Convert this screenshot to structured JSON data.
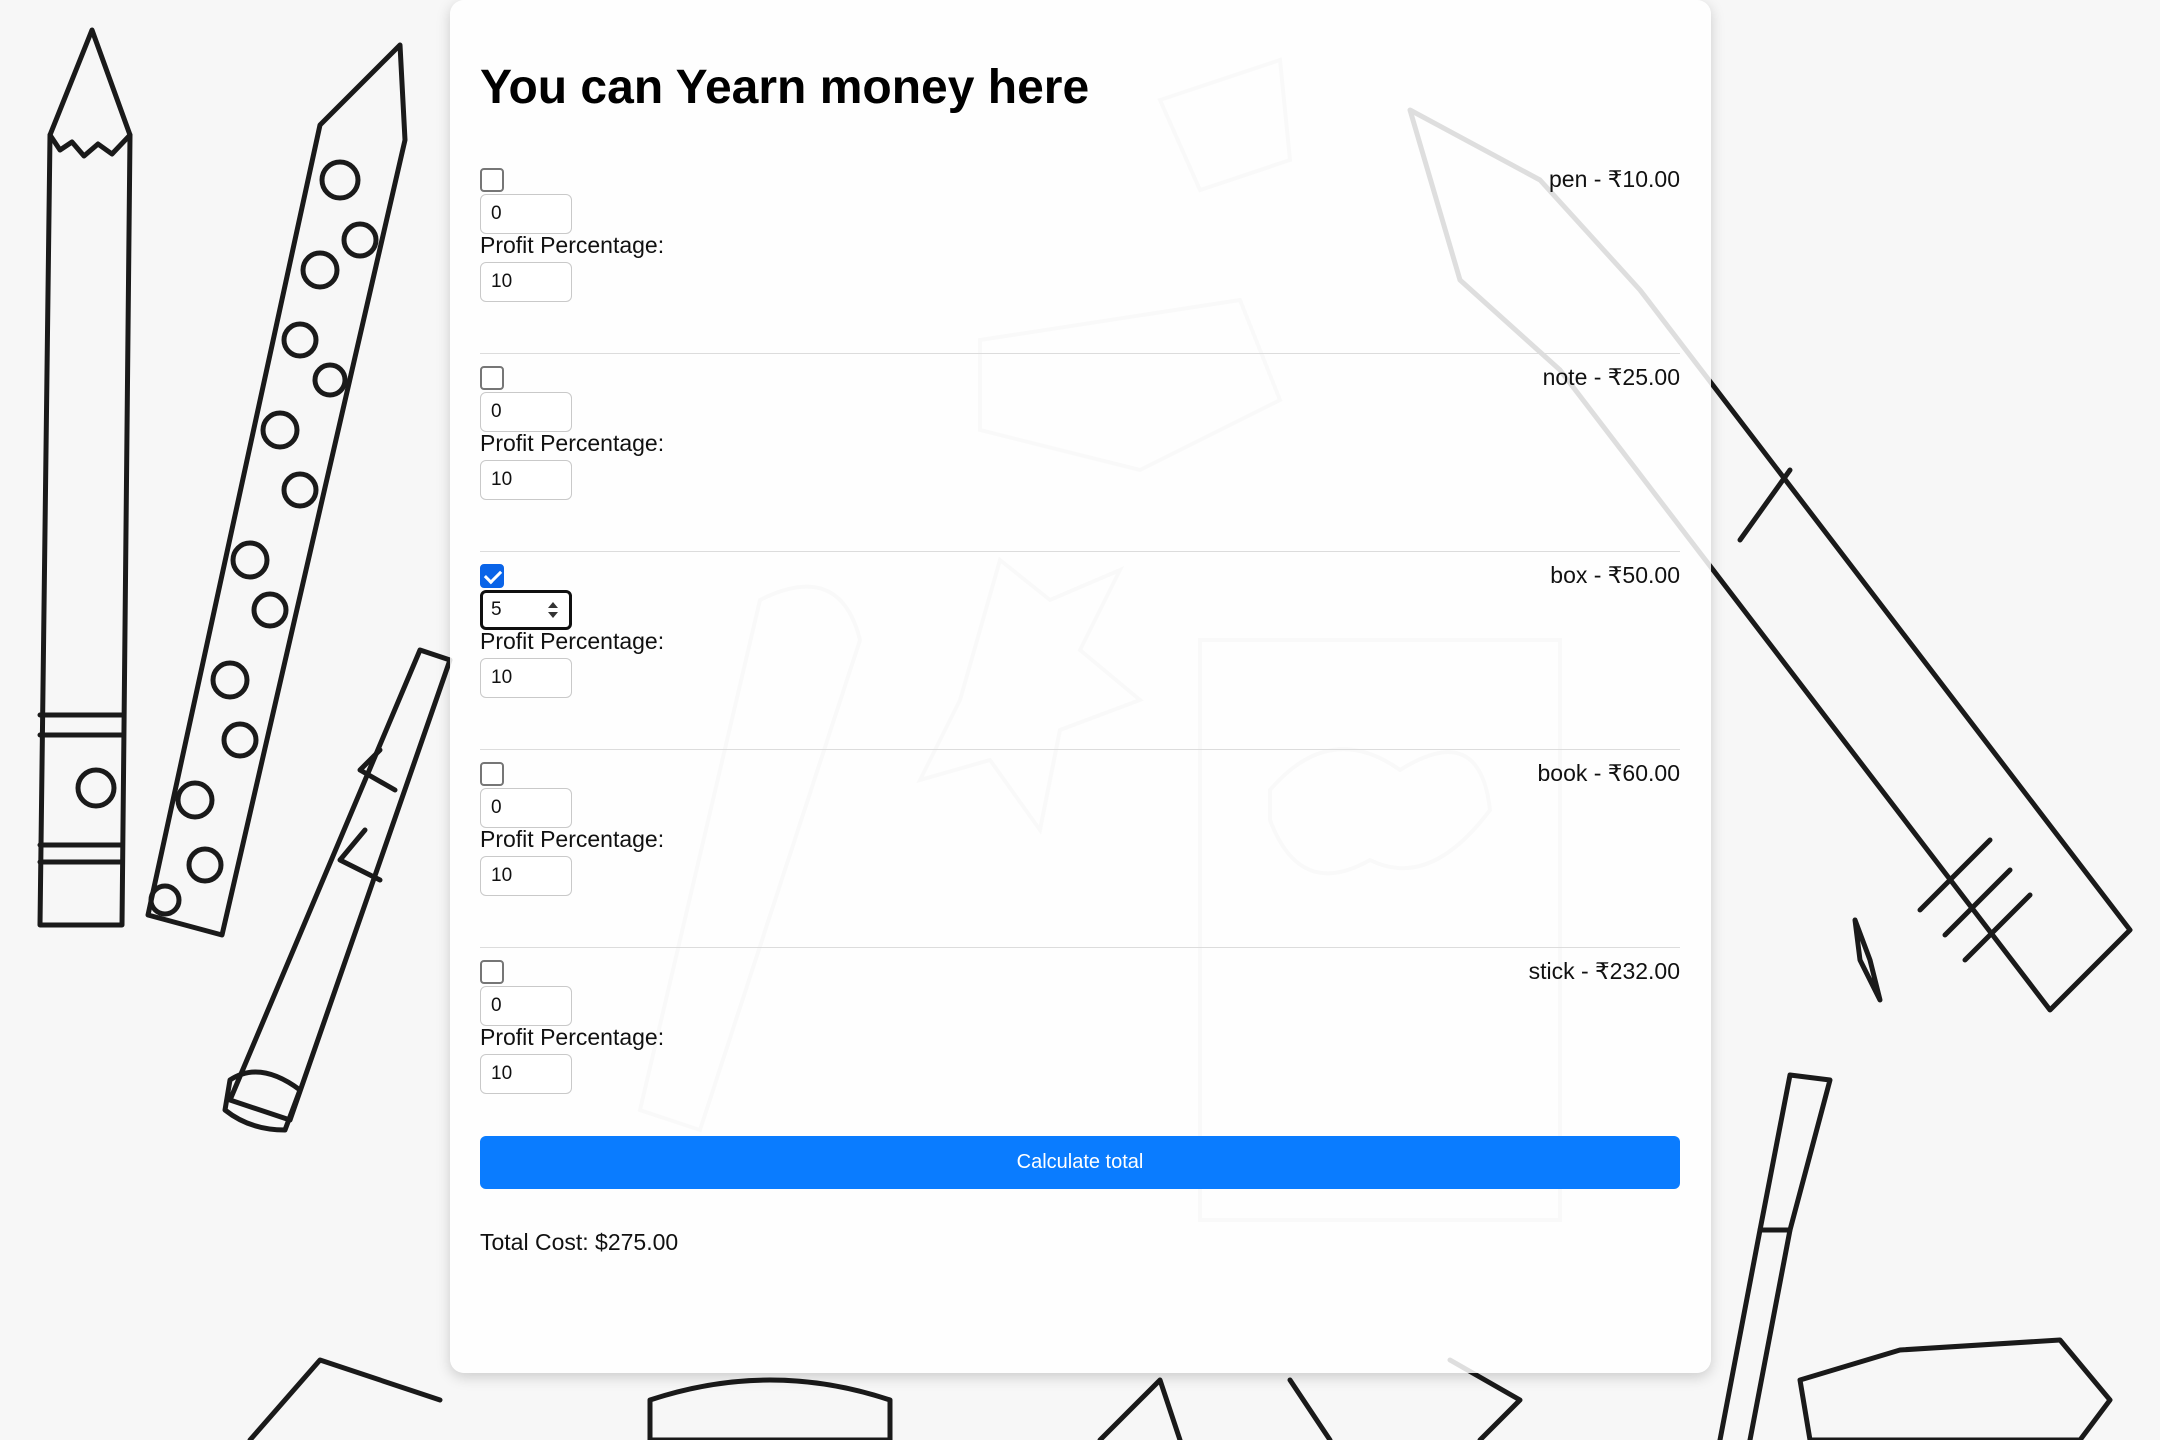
{
  "page": {
    "title": "You can Yearn money here"
  },
  "products": [
    {
      "checked": false,
      "quantity": "0",
      "profit_label": "Profit Percentage:",
      "profit": "10",
      "price_label": "pen - ₹10.00"
    },
    {
      "checked": false,
      "quantity": "0",
      "profit_label": "Profit Percentage:",
      "profit": "10",
      "price_label": "note - ₹25.00"
    },
    {
      "checked": true,
      "quantity": "5",
      "profit_label": "Profit Percentage:",
      "profit": "10",
      "price_label": "box - ₹50.00"
    },
    {
      "checked": false,
      "quantity": "0",
      "profit_label": "Profit Percentage:",
      "profit": "10",
      "price_label": "book - ₹60.00"
    },
    {
      "checked": false,
      "quantity": "0",
      "profit_label": "Profit Percentage:",
      "profit": "10",
      "price_label": "stick - ₹232.00"
    }
  ],
  "actions": {
    "calculate_label": "Calculate total"
  },
  "result": {
    "total_text": "Total Cost: $275.00"
  },
  "colors": {
    "button": "#0a7cff",
    "checkbox_checked": "#0a64e8",
    "background": "#f7f7f7"
  },
  "icons": {
    "background_illustration": "stationery-doodles",
    "spinner": "number-spinner-icon"
  }
}
